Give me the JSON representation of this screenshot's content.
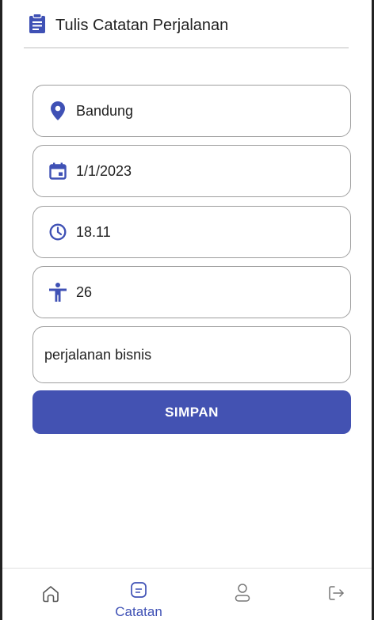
{
  "header": {
    "title": "Tulis Catatan Perjalanan",
    "icon": "clipboard-icon"
  },
  "form": {
    "location": {
      "value": "Bandung",
      "icon": "location-pin-icon"
    },
    "date": {
      "value": "1/1/2023",
      "icon": "calendar-icon"
    },
    "time": {
      "value": "18.11",
      "icon": "clock-icon"
    },
    "temperature": {
      "value": "26",
      "icon": "person-icon"
    },
    "note": {
      "value": "perjalanan bisnis"
    },
    "save_label": "SIMPAN"
  },
  "nav": {
    "items": [
      {
        "icon": "home-icon",
        "label": ""
      },
      {
        "icon": "note-icon",
        "label": "Catatan"
      },
      {
        "icon": "user-icon",
        "label": ""
      },
      {
        "icon": "logout-icon",
        "label": ""
      }
    ]
  },
  "colors": {
    "accent": "#4352b2",
    "icon": "#3f51b5"
  }
}
